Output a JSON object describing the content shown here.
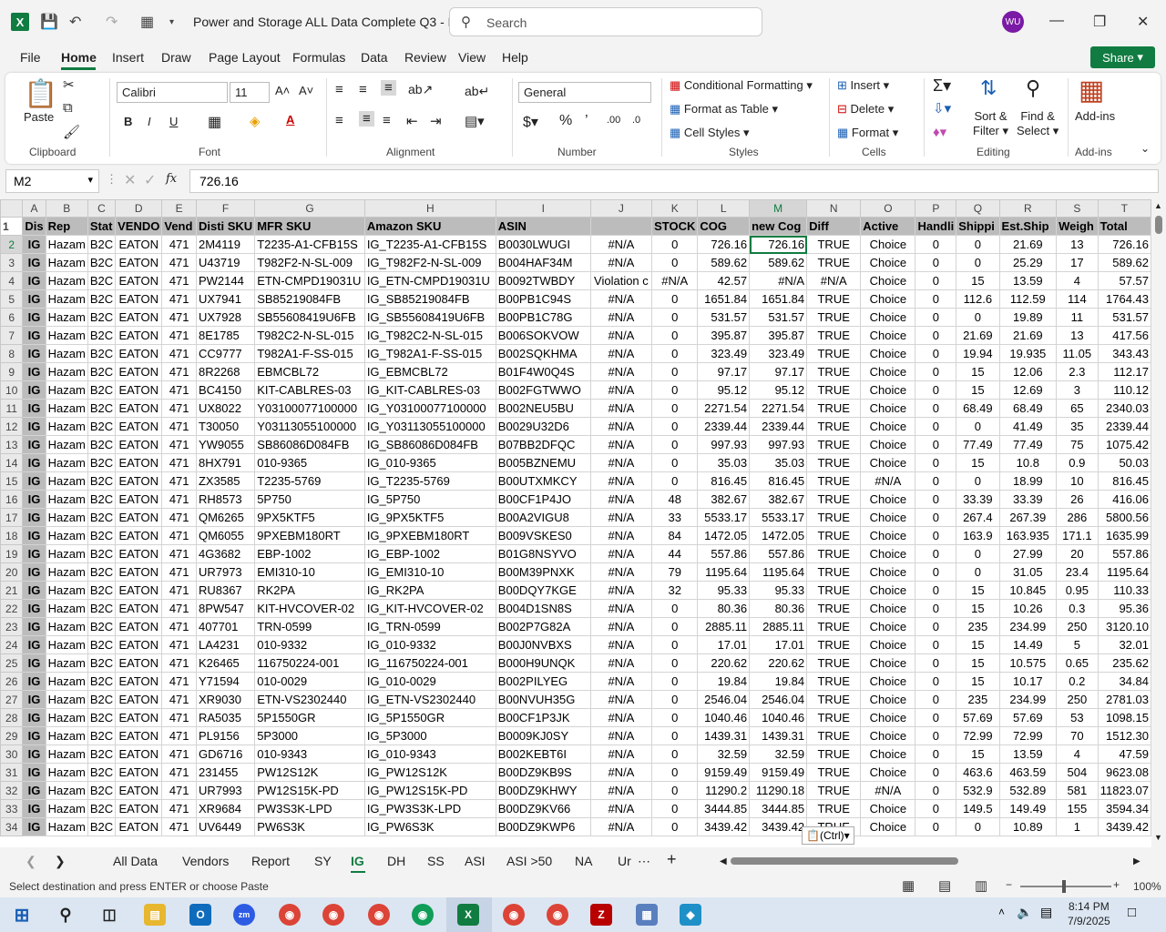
{
  "window": {
    "title": "Power and Storage ALL Data Complete Q3 - E...",
    "search_placeholder": "Search",
    "user_initials": "WU",
    "share_label": "Share"
  },
  "menu": [
    "File",
    "Home",
    "Insert",
    "Draw",
    "Page Layout",
    "Formulas",
    "Data",
    "Review",
    "View",
    "Help"
  ],
  "ribbon": {
    "clipboard": {
      "paste": "Paste",
      "label": "Clipboard"
    },
    "font": {
      "name": "Calibri",
      "size": "11",
      "label": "Font"
    },
    "alignment": {
      "label": "Alignment"
    },
    "number": {
      "format": "General",
      "label": "Number"
    },
    "styles": {
      "conditional": "Conditional Formatting",
      "format_table": "Format as Table",
      "cell_styles": "Cell Styles",
      "label": "Styles"
    },
    "cells": {
      "insert": "Insert",
      "delete": "Delete",
      "format": "Format",
      "label": "Cells"
    },
    "editing": {
      "sort": "Sort &",
      "filter": "Filter",
      "find": "Find &",
      "select": "Select",
      "label": "Editing"
    },
    "addins": {
      "label": "Add-ins",
      "btn": "Add-ins"
    }
  },
  "formula_bar": {
    "name_box": "M2",
    "formula": "726.16"
  },
  "columns": [
    "A",
    "B",
    "C",
    "D",
    "E",
    "F",
    "G",
    "H",
    "I",
    "J",
    "K",
    "L",
    "M",
    "N",
    "O",
    "P",
    "Q",
    "R",
    "S",
    "T"
  ],
  "header_row": [
    "Dis",
    "Rep",
    "Stat",
    "VENDO",
    "Vend",
    "Disti SKU",
    "MFR SKU",
    "Amazon SKU",
    "ASIN",
    "",
    "STOCK",
    "COG",
    "new Cog",
    "Diff",
    "Active",
    "Handli",
    "Shippi",
    "Est.Ship",
    "Weigh",
    "Total"
  ],
  "rows": [
    [
      "2",
      "IG",
      "Hazam",
      "B2C",
      "EATON",
      "471",
      "2M4119",
      "T2235-A1-CFB15S",
      "IG_T2235-A1-CFB15S",
      "B0030LWUGI",
      "#N/A",
      "0",
      "726.16",
      "726.16",
      "TRUE",
      "Choice",
      "0",
      "0",
      "21.69",
      "13",
      "726.16"
    ],
    [
      "3",
      "IG",
      "Hazam",
      "B2C",
      "EATON",
      "471",
      "U43719",
      "T982F2-N-SL-009",
      "IG_T982F2-N-SL-009",
      "B004HAF34M",
      "#N/A",
      "0",
      "589.62",
      "589.62",
      "TRUE",
      "Choice",
      "0",
      "0",
      "25.29",
      "17",
      "589.62"
    ],
    [
      "4",
      "IG",
      "Hazam",
      "B2C",
      "EATON",
      "471",
      "PW2144",
      "ETN-CMPD19031U",
      "IG_ETN-CMPD19031U",
      "B0092TWBDY",
      "Violation c",
      "#N/A",
      "42.57",
      "#N/A",
      "#N/A",
      "Choice",
      "0",
      "15",
      "13.59",
      "4",
      "57.57"
    ],
    [
      "5",
      "IG",
      "Hazam",
      "B2C",
      "EATON",
      "471",
      "UX7941",
      "SB85219084FB",
      "IG_SB85219084FB",
      "B00PB1C94S",
      "#N/A",
      "0",
      "1651.84",
      "1651.84",
      "TRUE",
      "Choice",
      "0",
      "112.6",
      "112.59",
      "114",
      "1764.43"
    ],
    [
      "6",
      "IG",
      "Hazam",
      "B2C",
      "EATON",
      "471",
      "UX7928",
      "SB55608419U6FB",
      "IG_SB55608419U6FB",
      "B00PB1C78G",
      "#N/A",
      "0",
      "531.57",
      "531.57",
      "TRUE",
      "Choice",
      "0",
      "0",
      "19.89",
      "11",
      "531.57"
    ],
    [
      "7",
      "IG",
      "Hazam",
      "B2C",
      "EATON",
      "471",
      "8E1785",
      "T982C2-N-SL-015",
      "IG_T982C2-N-SL-015",
      "B006SOKVOW",
      "#N/A",
      "0",
      "395.87",
      "395.87",
      "TRUE",
      "Choice",
      "0",
      "21.69",
      "21.69",
      "13",
      "417.56"
    ],
    [
      "8",
      "IG",
      "Hazam",
      "B2C",
      "EATON",
      "471",
      "CC9777",
      "T982A1-F-SS-015",
      "IG_T982A1-F-SS-015",
      "B002SQKHMA",
      "#N/A",
      "0",
      "323.49",
      "323.49",
      "TRUE",
      "Choice",
      "0",
      "19.94",
      "19.935",
      "11.05",
      "343.43"
    ],
    [
      "9",
      "IG",
      "Hazam",
      "B2C",
      "EATON",
      "471",
      "8R2268",
      "EBMCBL72",
      "IG_EBMCBL72",
      "B01F4W0Q4S",
      "#N/A",
      "0",
      "97.17",
      "97.17",
      "TRUE",
      "Choice",
      "0",
      "15",
      "12.06",
      "2.3",
      "112.17"
    ],
    [
      "10",
      "IG",
      "Hazam",
      "B2C",
      "EATON",
      "471",
      "BC4150",
      "KIT-CABLRES-03",
      "IG_KIT-CABLRES-03",
      "B002FGTWWO",
      "#N/A",
      "0",
      "95.12",
      "95.12",
      "TRUE",
      "Choice",
      "0",
      "15",
      "12.69",
      "3",
      "110.12"
    ],
    [
      "11",
      "IG",
      "Hazam",
      "B2C",
      "EATON",
      "471",
      "UX8022",
      "Y03100077100000",
      "IG_Y03100077100000",
      "B002NEU5BU",
      "#N/A",
      "0",
      "2271.54",
      "2271.54",
      "TRUE",
      "Choice",
      "0",
      "68.49",
      "68.49",
      "65",
      "2340.03"
    ],
    [
      "12",
      "IG",
      "Hazam",
      "B2C",
      "EATON",
      "471",
      "T30050",
      "Y03113055100000",
      "IG_Y03113055100000",
      "B0029U32D6",
      "#N/A",
      "0",
      "2339.44",
      "2339.44",
      "TRUE",
      "Choice",
      "0",
      "0",
      "41.49",
      "35",
      "2339.44"
    ],
    [
      "13",
      "IG",
      "Hazam",
      "B2C",
      "EATON",
      "471",
      "YW9055",
      "SB86086D084FB",
      "IG_SB86086D084FB",
      "B07BB2DFQC",
      "#N/A",
      "0",
      "997.93",
      "997.93",
      "TRUE",
      "Choice",
      "0",
      "77.49",
      "77.49",
      "75",
      "1075.42"
    ],
    [
      "14",
      "IG",
      "Hazam",
      "B2C",
      "EATON",
      "471",
      "8HX791",
      "010-9365",
      "IG_010-9365",
      "B005BZNEMU",
      "#N/A",
      "0",
      "35.03",
      "35.03",
      "TRUE",
      "Choice",
      "0",
      "15",
      "10.8",
      "0.9",
      "50.03"
    ],
    [
      "15",
      "IG",
      "Hazam",
      "B2C",
      "EATON",
      "471",
      "ZX3585",
      "T2235-5769",
      "IG_T2235-5769",
      "B00UTXMKCY",
      "#N/A",
      "0",
      "816.45",
      "816.45",
      "TRUE",
      "#N/A",
      "0",
      "0",
      "18.99",
      "10",
      "816.45"
    ],
    [
      "16",
      "IG",
      "Hazam",
      "B2C",
      "EATON",
      "471",
      "RH8573",
      "5P750",
      "IG_5P750",
      "B00CF1P4JO",
      "#N/A",
      "48",
      "382.67",
      "382.67",
      "TRUE",
      "Choice",
      "0",
      "33.39",
      "33.39",
      "26",
      "416.06"
    ],
    [
      "17",
      "IG",
      "Hazam",
      "B2C",
      "EATON",
      "471",
      "QM6265",
      "9PX5KTF5",
      "IG_9PX5KTF5",
      "B00A2VIGU8",
      "#N/A",
      "33",
      "5533.17",
      "5533.17",
      "TRUE",
      "Choice",
      "0",
      "267.4",
      "267.39",
      "286",
      "5800.56"
    ],
    [
      "18",
      "IG",
      "Hazam",
      "B2C",
      "EATON",
      "471",
      "QM6055",
      "9PXEBM180RT",
      "IG_9PXEBM180RT",
      "B009VSKES0",
      "#N/A",
      "84",
      "1472.05",
      "1472.05",
      "TRUE",
      "Choice",
      "0",
      "163.9",
      "163.935",
      "171.1",
      "1635.99"
    ],
    [
      "19",
      "IG",
      "Hazam",
      "B2C",
      "EATON",
      "471",
      "4G3682",
      "EBP-1002",
      "IG_EBP-1002",
      "B01G8NSYVO",
      "#N/A",
      "44",
      "557.86",
      "557.86",
      "TRUE",
      "Choice",
      "0",
      "0",
      "27.99",
      "20",
      "557.86"
    ],
    [
      "20",
      "IG",
      "Hazam",
      "B2C",
      "EATON",
      "471",
      "UR7973",
      "EMI310-10",
      "IG_EMI310-10",
      "B00M39PNXK",
      "#N/A",
      "79",
      "1195.64",
      "1195.64",
      "TRUE",
      "Choice",
      "0",
      "0",
      "31.05",
      "23.4",
      "1195.64"
    ],
    [
      "21",
      "IG",
      "Hazam",
      "B2C",
      "EATON",
      "471",
      "RU8367",
      "RK2PA",
      "IG_RK2PA",
      "B00DQY7KGE",
      "#N/A",
      "32",
      "95.33",
      "95.33",
      "TRUE",
      "Choice",
      "0",
      "15",
      "10.845",
      "0.95",
      "110.33"
    ],
    [
      "22",
      "IG",
      "Hazam",
      "B2C",
      "EATON",
      "471",
      "8PW547",
      "KIT-HVCOVER-02",
      "IG_KIT-HVCOVER-02",
      "B004D1SN8S",
      "#N/A",
      "0",
      "80.36",
      "80.36",
      "TRUE",
      "Choice",
      "0",
      "15",
      "10.26",
      "0.3",
      "95.36"
    ],
    [
      "23",
      "IG",
      "Hazam",
      "B2C",
      "EATON",
      "471",
      "407701",
      "TRN-0599",
      "IG_TRN-0599",
      "B002P7G82A",
      "#N/A",
      "0",
      "2885.11",
      "2885.11",
      "TRUE",
      "Choice",
      "0",
      "235",
      "234.99",
      "250",
      "3120.10"
    ],
    [
      "24",
      "IG",
      "Hazam",
      "B2C",
      "EATON",
      "471",
      "LA4231",
      "010-9332",
      "IG_010-9332",
      "B00J0NVBXS",
      "#N/A",
      "0",
      "17.01",
      "17.01",
      "TRUE",
      "Choice",
      "0",
      "15",
      "14.49",
      "5",
      "32.01"
    ],
    [
      "25",
      "IG",
      "Hazam",
      "B2C",
      "EATON",
      "471",
      "K26465",
      "116750224-001",
      "IG_116750224-001",
      "B000H9UNQK",
      "#N/A",
      "0",
      "220.62",
      "220.62",
      "TRUE",
      "Choice",
      "0",
      "15",
      "10.575",
      "0.65",
      "235.62"
    ],
    [
      "26",
      "IG",
      "Hazam",
      "B2C",
      "EATON",
      "471",
      "Y71594",
      "010-0029",
      "IG_010-0029",
      "B002PILYEG",
      "#N/A",
      "0",
      "19.84",
      "19.84",
      "TRUE",
      "Choice",
      "0",
      "15",
      "10.17",
      "0.2",
      "34.84"
    ],
    [
      "27",
      "IG",
      "Hazam",
      "B2C",
      "EATON",
      "471",
      "XR9030",
      "ETN-VS2302440",
      "IG_ETN-VS2302440",
      "B00NVUH35G",
      "#N/A",
      "0",
      "2546.04",
      "2546.04",
      "TRUE",
      "Choice",
      "0",
      "235",
      "234.99",
      "250",
      "2781.03"
    ],
    [
      "28",
      "IG",
      "Hazam",
      "B2C",
      "EATON",
      "471",
      "RA5035",
      "5P1550GR",
      "IG_5P1550GR",
      "B00CF1P3JK",
      "#N/A",
      "0",
      "1040.46",
      "1040.46",
      "TRUE",
      "Choice",
      "0",
      "57.69",
      "57.69",
      "53",
      "1098.15"
    ],
    [
      "29",
      "IG",
      "Hazam",
      "B2C",
      "EATON",
      "471",
      "PL9156",
      "5P3000",
      "IG_5P3000",
      "B0009KJ0SY",
      "#N/A",
      "0",
      "1439.31",
      "1439.31",
      "TRUE",
      "Choice",
      "0",
      "72.99",
      "72.99",
      "70",
      "1512.30"
    ],
    [
      "30",
      "IG",
      "Hazam",
      "B2C",
      "EATON",
      "471",
      "GD6716",
      "010-9343",
      "IG_010-9343",
      "B002KEBT6I",
      "#N/A",
      "0",
      "32.59",
      "32.59",
      "TRUE",
      "Choice",
      "0",
      "15",
      "13.59",
      "4",
      "47.59"
    ],
    [
      "31",
      "IG",
      "Hazam",
      "B2C",
      "EATON",
      "471",
      "231455",
      "PW12S12K",
      "IG_PW12S12K",
      "B00DZ9KB9S",
      "#N/A",
      "0",
      "9159.49",
      "9159.49",
      "TRUE",
      "Choice",
      "0",
      "463.6",
      "463.59",
      "504",
      "9623.08"
    ],
    [
      "32",
      "IG",
      "Hazam",
      "B2C",
      "EATON",
      "471",
      "UR7993",
      "PW12S15K-PD",
      "IG_PW12S15K-PD",
      "B00DZ9KHWY",
      "#N/A",
      "0",
      "11290.2",
      "11290.18",
      "TRUE",
      "#N/A",
      "0",
      "532.9",
      "532.89",
      "581",
      "11823.07"
    ],
    [
      "33",
      "IG",
      "Hazam",
      "B2C",
      "EATON",
      "471",
      "XR9684",
      "PW3S3K-LPD",
      "IG_PW3S3K-LPD",
      "B00DZ9KV66",
      "#N/A",
      "0",
      "3444.85",
      "3444.85",
      "TRUE",
      "Choice",
      "0",
      "149.5",
      "149.49",
      "155",
      "3594.34"
    ],
    [
      "34",
      "IG",
      "Hazam",
      "B2C",
      "EATON",
      "471",
      "UV6449",
      "PW6S3K",
      "IG_PW6S3K",
      "B00DZ9KWP6",
      "#N/A",
      "0",
      "3439.42",
      "3439.42",
      "TRUE",
      "Choice",
      "0",
      "0",
      "10.89",
      "1",
      "3439.42"
    ]
  ],
  "paste_popup": "(Ctrl)",
  "sheets": [
    "All Data",
    "Vendors",
    "Report",
    "SY",
    "IG",
    "DH",
    "SS",
    "ASI",
    "ASI >50",
    "NA",
    "Ur"
  ],
  "active_sheet": "IG",
  "status": {
    "message": "Select destination and press ENTER or choose Paste",
    "zoom": "100%"
  },
  "clock": {
    "time": "8:14 PM",
    "date": "7/9/2025"
  }
}
